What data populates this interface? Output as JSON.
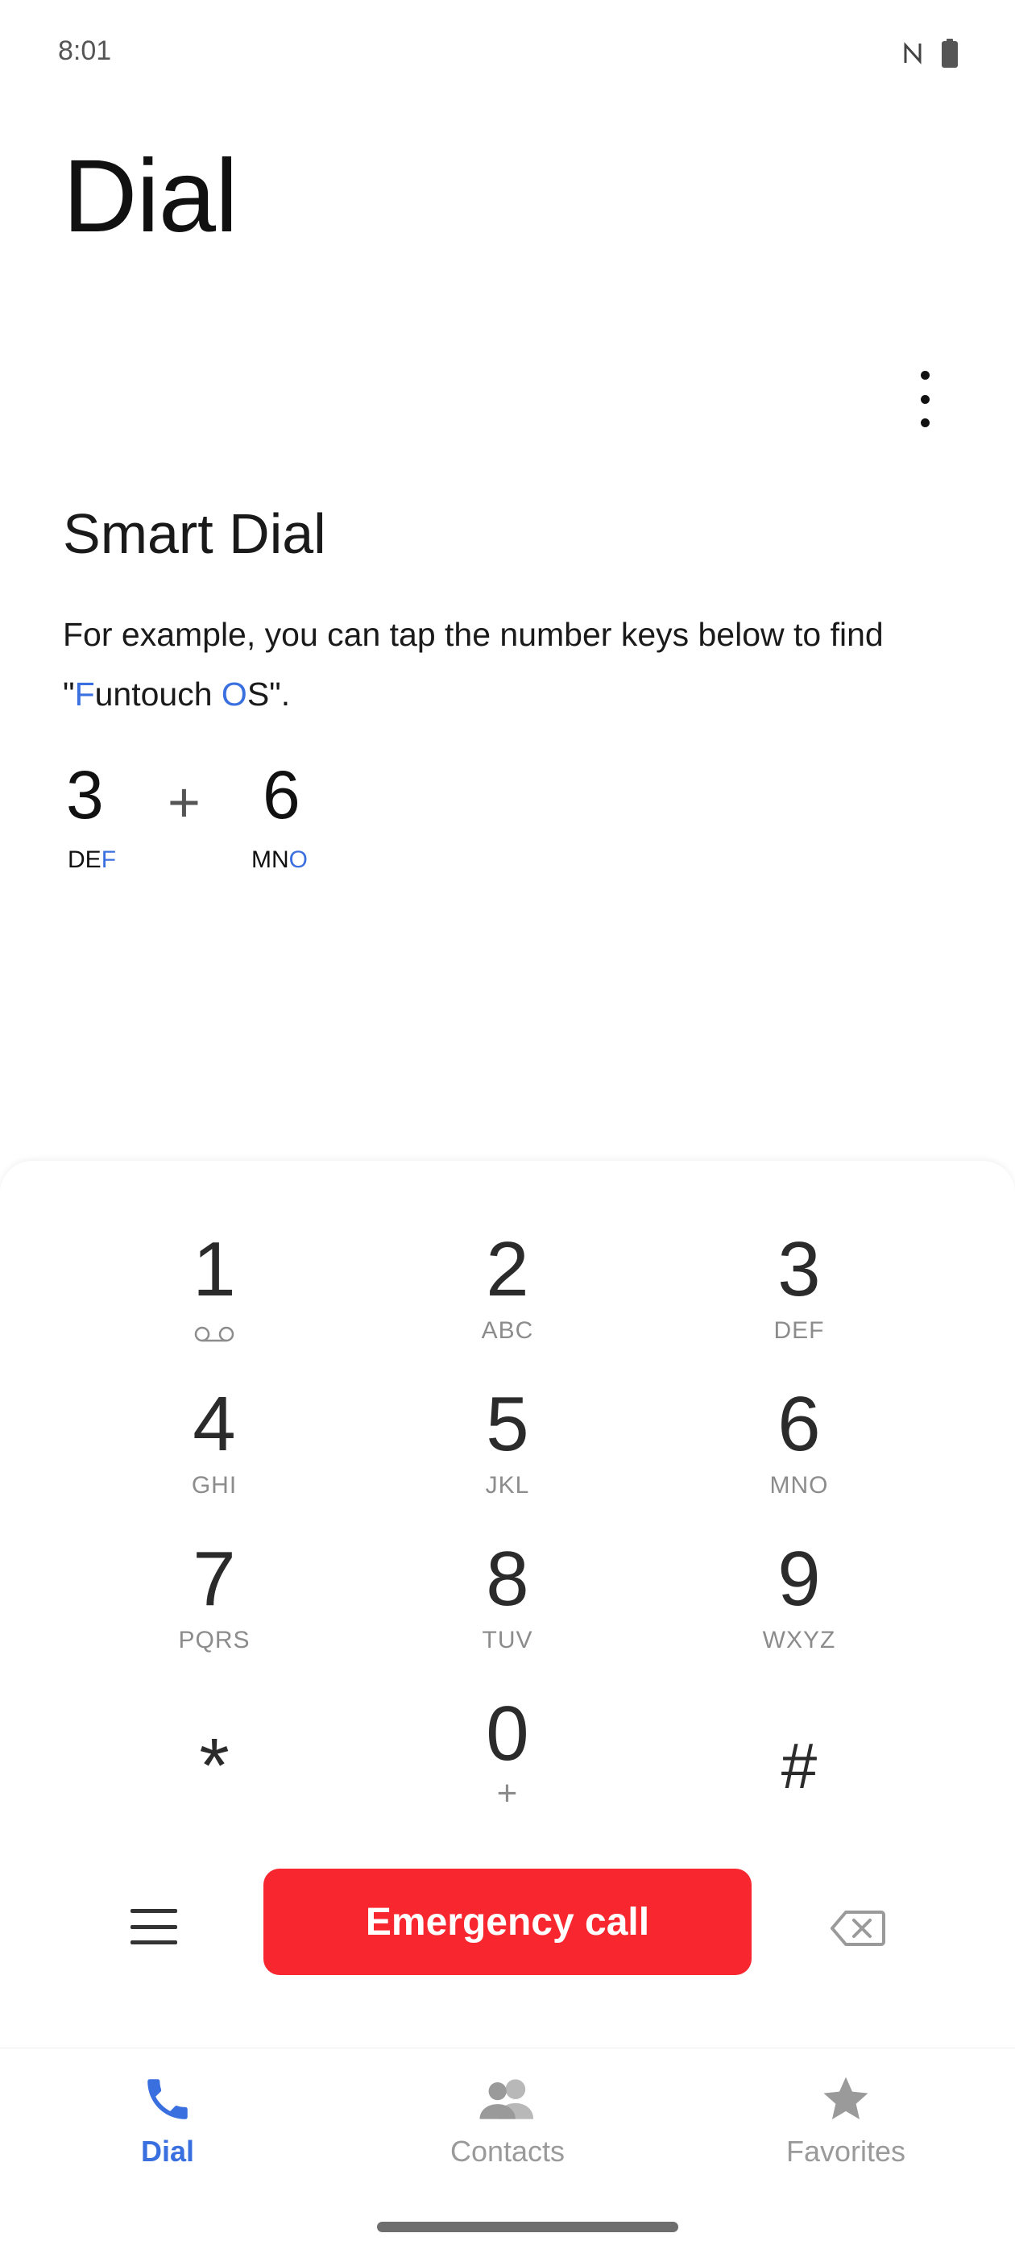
{
  "status_bar": {
    "time": "8:01",
    "icons": [
      "nfc-icon",
      "battery-icon"
    ]
  },
  "header": {
    "title": "Dial",
    "more_icon": "more-vert-icon"
  },
  "smart_dial": {
    "title": "Smart Dial",
    "desc_part1": "For example, you can tap the number keys below to find \"",
    "desc_hl1": "F",
    "desc_part2": "untouch ",
    "desc_hl2": "O",
    "desc_part3": "S\".",
    "example": {
      "key1_digit": "3",
      "key1_letters_plain": "DE",
      "key1_letters_hl": "F",
      "plus": "+",
      "key2_digit": "6",
      "key2_letters_plain": "MN",
      "key2_letters_hl": "O"
    }
  },
  "keypad": {
    "keys": [
      {
        "num": "1",
        "sub": "voicemail-icon"
      },
      {
        "num": "2",
        "sub": "ABC"
      },
      {
        "num": "3",
        "sub": "DEF"
      },
      {
        "num": "4",
        "sub": "GHI"
      },
      {
        "num": "5",
        "sub": "JKL"
      },
      {
        "num": "6",
        "sub": "MNO"
      },
      {
        "num": "7",
        "sub": "PQRS"
      },
      {
        "num": "8",
        "sub": "TUV"
      },
      {
        "num": "9",
        "sub": "WXYZ"
      },
      {
        "num": "*",
        "sub": ""
      },
      {
        "num": "0",
        "sub": "+"
      },
      {
        "num": "#",
        "sub": ""
      }
    ],
    "emergency_label": "Emergency call",
    "accent_red": "#f7262f"
  },
  "bottom_nav": {
    "items": [
      {
        "label": "Dial",
        "icon": "phone-icon",
        "active": true
      },
      {
        "label": "Contacts",
        "icon": "contacts-icon",
        "active": false
      },
      {
        "label": "Favorites",
        "icon": "star-icon",
        "active": false
      }
    ],
    "accent_blue": "#3a6fe0"
  }
}
